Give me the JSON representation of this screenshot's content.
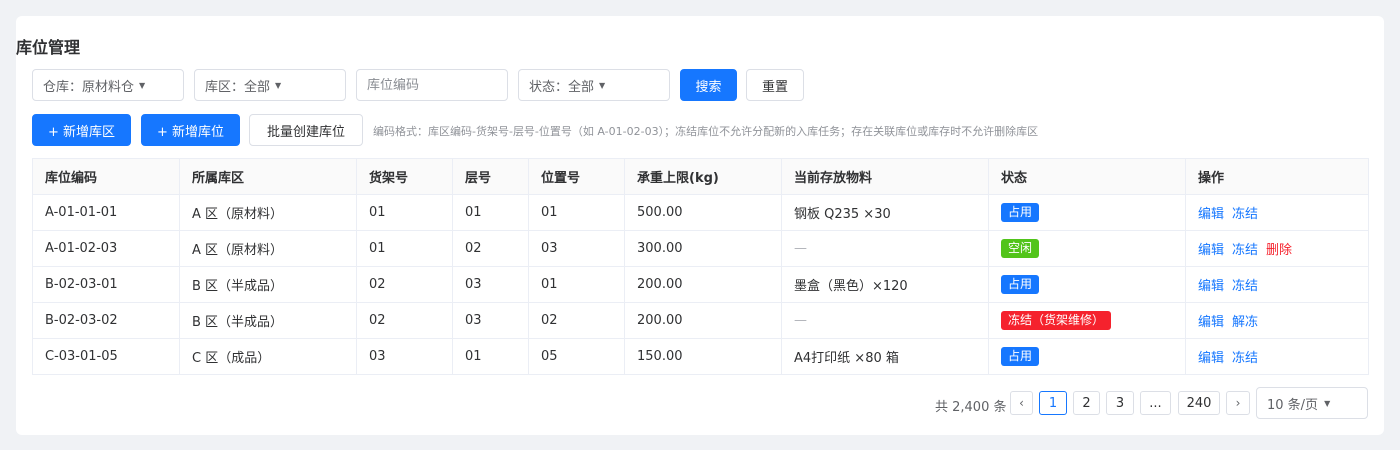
{
  "title": "库位管理",
  "filters": {
    "warehouse": "仓库：原材料仓",
    "zone": "库区：全部",
    "code_placeholder": "库位编码",
    "status": "状态：全部"
  },
  "buttons": {
    "search": "搜索",
    "reset": "重置",
    "add_zone": "+ 新增库区",
    "add_location": "+ 新增库位",
    "batch_create": "批量创建库位"
  },
  "hint": "编码格式：库区编码-货架号-层号-位置号（如 A-01-02-03）；冻结库位不允许分配新的入库任务；存在关联库位或库存时不允许删除库区",
  "table": {
    "columns": [
      "库位编码",
      "所属库区",
      "货架号",
      "层号",
      "位置号",
      "承重上限(kg)",
      "当前存放物料",
      "状态",
      "操作"
    ],
    "rows": [
      {
        "code": "A-01-01-01",
        "zone": "A 区（原材料）",
        "shelf": "01",
        "layer": "01",
        "position": "01",
        "load": "500.00",
        "material": "钢板 Q235 ×30",
        "status": "占用",
        "status_color": "#1677ff",
        "ops": [
          "编辑",
          "冻结"
        ]
      },
      {
        "code": "A-01-02-03",
        "zone": "A 区（原材料）",
        "shelf": "01",
        "layer": "02",
        "position": "03",
        "load": "300.00",
        "material": "—",
        "status": "空闲",
        "status_color": "#52c41a",
        "ops": [
          "编辑",
          "冻结",
          "删除"
        ]
      },
      {
        "code": "B-02-03-01",
        "zone": "B 区（半成品）",
        "shelf": "02",
        "layer": "03",
        "position": "01",
        "load": "200.00",
        "material": "墨盒（黑色）×120",
        "status": "占用",
        "status_color": "#1677ff",
        "ops": [
          "编辑",
          "冻结"
        ]
      },
      {
        "code": "B-02-03-02",
        "zone": "B 区（半成品）",
        "shelf": "02",
        "layer": "03",
        "position": "02",
        "load": "200.00",
        "material": "—",
        "status": "冻结（货架维修）",
        "status_color": "#f5222d",
        "ops": [
          "编辑",
          "解冻"
        ]
      },
      {
        "code": "C-03-01-05",
        "zone": "C 区（成品）",
        "shelf": "03",
        "layer": "01",
        "position": "05",
        "load": "150.00",
        "material": "A4打印纸 ×80 箱",
        "status": "占用",
        "status_color": "#1677ff",
        "ops": [
          "编辑",
          "冻结"
        ]
      }
    ]
  },
  "pagination": {
    "total": "共 2,400 条",
    "prev": "‹",
    "next": "›",
    "pages": [
      "1",
      "2",
      "3",
      "...",
      "240"
    ],
    "current": "1",
    "page_size": "10 条/页"
  }
}
